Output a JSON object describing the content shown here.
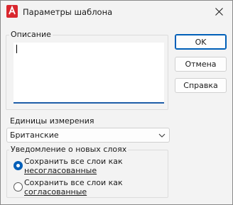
{
  "window": {
    "title": "Параметры шаблона",
    "app_icon": "autocad-a-icon",
    "close_icon": "close-icon"
  },
  "description": {
    "label": "Описание",
    "value": ""
  },
  "buttons": {
    "ok": "OK",
    "cancel": "Отмена",
    "help": "Справка"
  },
  "units": {
    "label": "Единицы измерения",
    "selected": "Британские",
    "dropdown_icon": "chevron-down-icon"
  },
  "layer_notification": {
    "label": "Уведомление о новых слоях",
    "options": [
      {
        "line1": "Сохранить все слои как",
        "line2": "несогласованные",
        "checked": true
      },
      {
        "line1": "Сохранить все слои как",
        "line2": "согласованные",
        "checked": false
      }
    ]
  },
  "colors": {
    "accent": "#005fb8",
    "app_icon_red": "#d9272e"
  }
}
